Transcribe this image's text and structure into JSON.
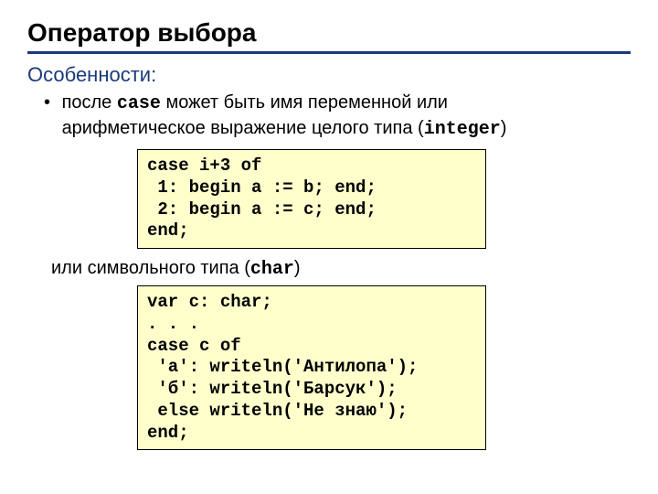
{
  "title": "Оператор выбора",
  "features_label": "Особенности:",
  "bullet1_pre": "после ",
  "bullet1_kw": "case",
  "bullet1_mid": " может быть имя переменной или арифметическое выражение целого типа (",
  "bullet1_kw2": "integer",
  "bullet1_post": ")",
  "code1": "case i+3 of\n 1: begin a := b; end;\n 2: begin a := c; end;\nend;",
  "or_text_pre": "или символьного типа (",
  "or_kw": "char",
  "or_text_post": ")",
  "code2": "var c: char;\n. . .\ncase c of\n 'а': writeln('Антилопа');\n 'б': writeln('Барсук');\n else writeln('Не знаю');\nend;"
}
